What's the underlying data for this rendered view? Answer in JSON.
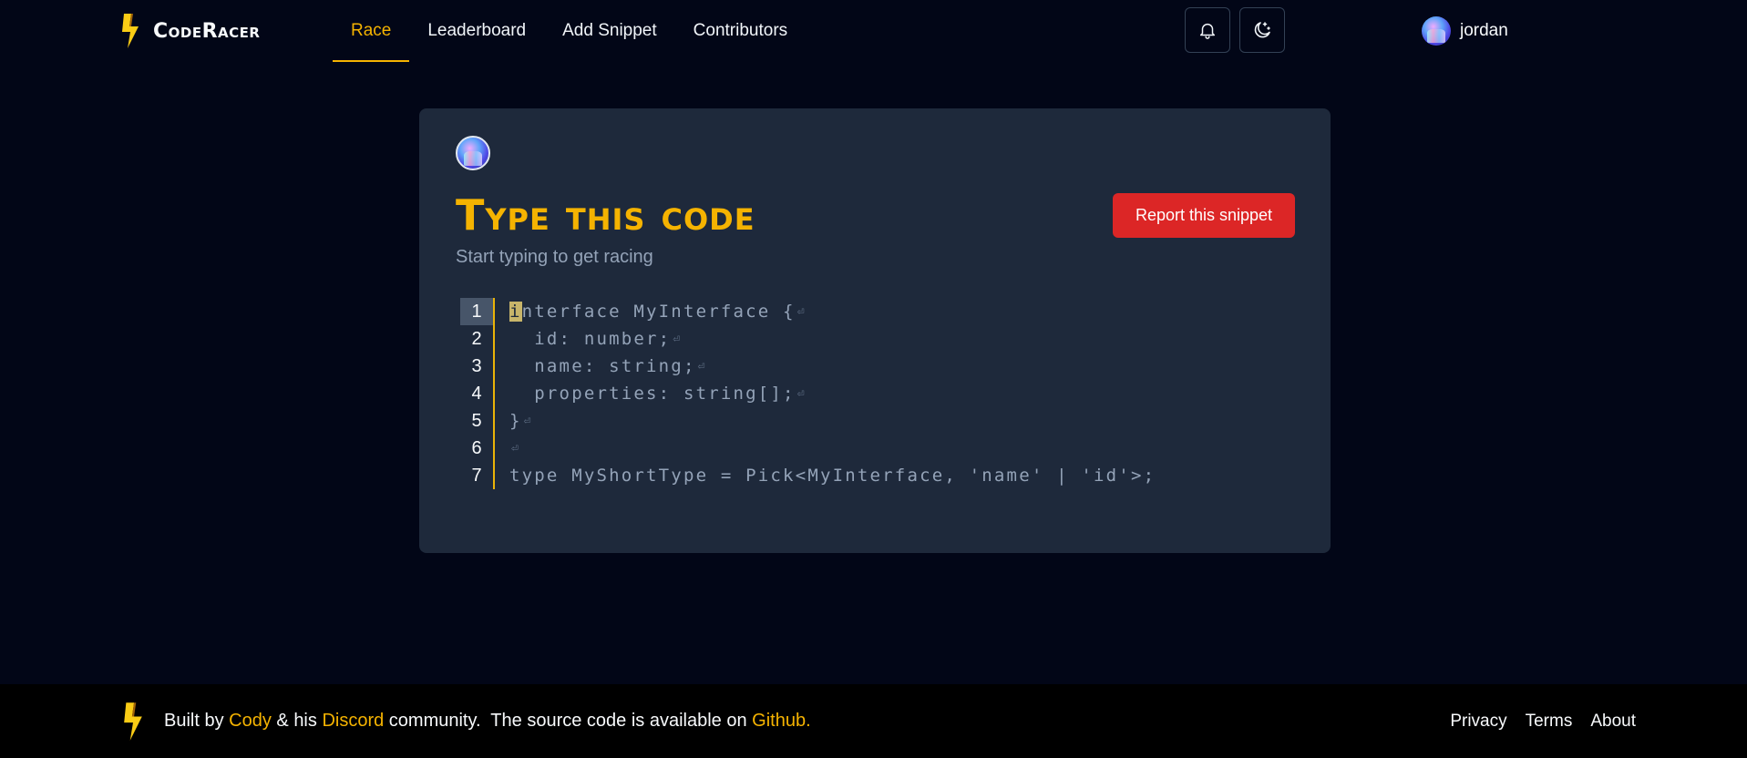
{
  "header": {
    "logo_text": "CodeRacer",
    "nav": [
      {
        "label": "Race",
        "active": true
      },
      {
        "label": "Leaderboard",
        "active": false
      },
      {
        "label": "Add Snippet",
        "active": false
      },
      {
        "label": "Contributors",
        "active": false
      }
    ],
    "notifications_icon": "bell-icon",
    "theme_icon": "moon-stars-icon",
    "user": {
      "name": "jordan"
    }
  },
  "card": {
    "title": "Type this code",
    "subtitle": "Start typing to get racing",
    "report_label": "Report this snippet",
    "code": {
      "current_line": 1,
      "line_numbers": [
        "1",
        "2",
        "3",
        "4",
        "5",
        "6",
        "7"
      ],
      "lines": [
        "interface MyInterface {",
        "  id: number;",
        "  name: string;",
        "  properties: string[];",
        "}",
        "",
        "type MyShortType = Pick<MyInterface, 'name' | 'id'>;"
      ],
      "newline_glyph": "⏎"
    }
  },
  "footer": {
    "built_by": "Built by ",
    "cody": "Cody",
    "and_his": " & his ",
    "discord": "Discord",
    "community": " community.  The source code is available on ",
    "github": "Github.",
    "links": [
      "Privacy",
      "Terms",
      "About"
    ]
  },
  "colors": {
    "accent": "#f5b301",
    "background": "#020617",
    "card": "#1e293b",
    "danger": "#dc2626"
  }
}
